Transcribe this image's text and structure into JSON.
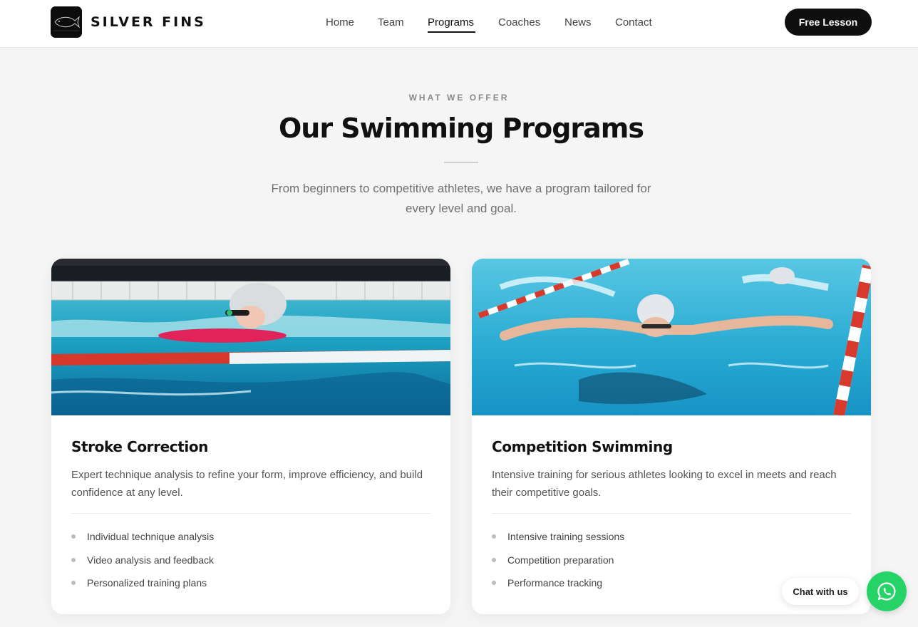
{
  "brand": {
    "name": "SILVER FINS",
    "logo_icon": "fish-logo-icon"
  },
  "nav": {
    "items": [
      {
        "label": "Home"
      },
      {
        "label": "Team"
      },
      {
        "label": "Programs",
        "active": true
      },
      {
        "label": "Coaches"
      },
      {
        "label": "News"
      },
      {
        "label": "Contact"
      }
    ],
    "cta_label": "Free Lesson"
  },
  "section": {
    "eyebrow": "WHAT WE OFFER",
    "title": "Our Swimming Programs",
    "subtitle": "From beginners to competitive athletes, we have a program tailored for every level and goal."
  },
  "programs": [
    {
      "title": "Stroke Correction",
      "description": "Expert technique analysis to refine your form, improve efficiency, and build confidence at any level.",
      "features": [
        "Individual technique analysis",
        "Video analysis and feedback",
        "Personalized training plans"
      ]
    },
    {
      "title": "Competition Swimming",
      "description": "Intensive training for serious athletes looking to excel in meets and reach their competitive goals.",
      "features": [
        "Intensive training sessions",
        "Competition preparation",
        "Performance tracking"
      ]
    }
  ],
  "chat": {
    "label": "Chat with us",
    "icon": "whatsapp-icon"
  },
  "colors": {
    "accent": "#111111",
    "chat_green": "#25d366",
    "background": "#f5f5f5"
  }
}
